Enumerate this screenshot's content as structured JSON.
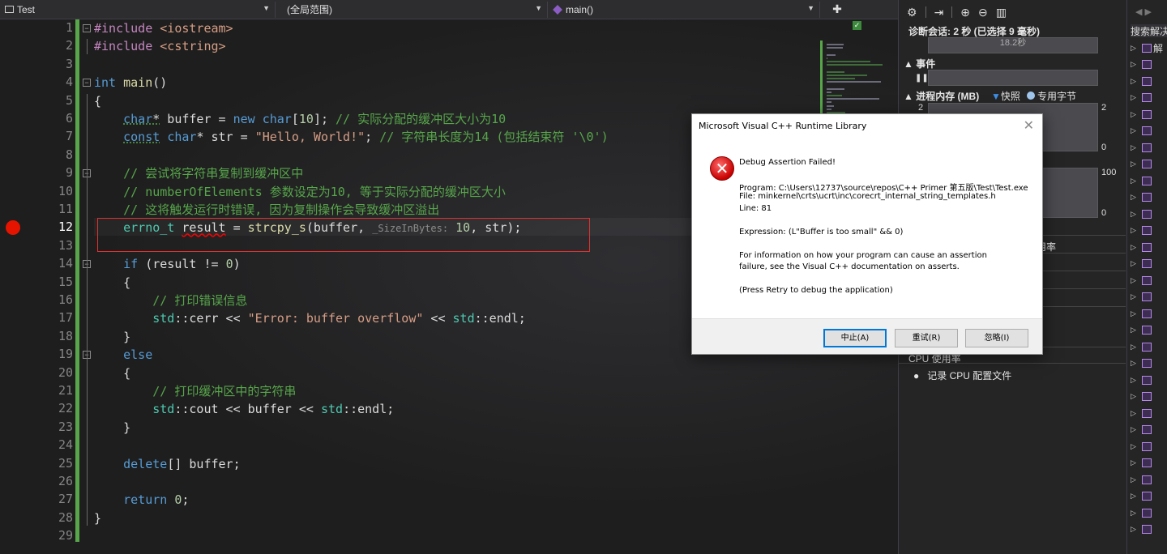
{
  "navbar": {
    "project": "Test",
    "scope": "(全局范围)",
    "member": "main()",
    "split_icon": "split-window-icon"
  },
  "editor": {
    "current_line": 12,
    "breakpoint_line": 12,
    "lines": [
      {
        "n": "1",
        "t": "#include <iostream>"
      },
      {
        "n": "2",
        "t": "#include <cstring>"
      },
      {
        "n": "3",
        "t": ""
      },
      {
        "n": "4",
        "t": "int main()"
      },
      {
        "n": "5",
        "t": "{"
      },
      {
        "n": "6",
        "t": "    char* buffer = new char[10]; // 实际分配的缓冲区大小为10"
      },
      {
        "n": "7",
        "t": "    const char* str = \"Hello, World!\"; // 字符串长度为14 (包括结束符 '\\0')"
      },
      {
        "n": "8",
        "t": ""
      },
      {
        "n": "9",
        "t": "    // 尝试将字符串复制到缓冲区中"
      },
      {
        "n": "10",
        "t": "    // numberOfElements 参数设定为10, 等于实际分配的缓冲区大小"
      },
      {
        "n": "11",
        "t": "    // 这将触发运行时错误, 因为复制操作会导致缓冲区溢出"
      },
      {
        "n": "12",
        "t": "    errno_t result = strcpy_s(buffer, _SizeInBytes: 10, str);"
      },
      {
        "n": "13",
        "t": ""
      },
      {
        "n": "14",
        "t": "    if (result != 0)"
      },
      {
        "n": "15",
        "t": "    {"
      },
      {
        "n": "16",
        "t": "        // 打印错误信息"
      },
      {
        "n": "17",
        "t": "        std::cerr << \"Error: buffer overflow\" << std::endl;"
      },
      {
        "n": "18",
        "t": "    }"
      },
      {
        "n": "19",
        "t": "    else"
      },
      {
        "n": "20",
        "t": "    {"
      },
      {
        "n": "21",
        "t": "        // 打印缓冲区中的字符串"
      },
      {
        "n": "22",
        "t": "        std::cout << buffer << std::endl;"
      },
      {
        "n": "23",
        "t": "    }"
      },
      {
        "n": "24",
        "t": ""
      },
      {
        "n": "25",
        "t": "    delete[] buffer;"
      },
      {
        "n": "26",
        "t": ""
      },
      {
        "n": "27",
        "t": "    return 0;"
      },
      {
        "n": "28",
        "t": "}"
      },
      {
        "n": "29",
        "t": ""
      }
    ]
  },
  "diagnostics": {
    "session": "诊断会话: 2 秒 (已选择 9 毫秒)",
    "timeline_label": "18.2秒",
    "events_title": "事件",
    "memory_title": "进程内存 (MB)",
    "snapshot_label": "快照",
    "private_bytes_label": "专用字节",
    "mem_axis_top_left": "2",
    "mem_axis_top_right": "2",
    "mem_axis_bottom_right": "0",
    "cpu_axis_top": "100",
    "cpu_axis_bottom": "0",
    "usage_tab_fragment": "用率",
    "cpu_title": "CPU 使用率",
    "cpu_record": "记录 CPU 配置文件"
  },
  "right_panel": {
    "search": "搜索解决",
    "solution_fragment": "解"
  },
  "dialog": {
    "title": "Microsoft Visual C++ Runtime Library",
    "heading": "Debug Assertion Failed!",
    "program": "Program: C:\\Users\\12737\\source\\repos\\C++ Primer 第五版\\Test\\Test.exe",
    "file": "File: minkernel\\crts\\ucrt\\inc\\corecrt_internal_string_templates.h",
    "line": "Line: 81",
    "expression": "Expression: (L\"Buffer is too small\" && 0)",
    "info1": "For information on how your program can cause an assertion",
    "info2": "failure, see the Visual C++ documentation on asserts.",
    "retry_hint": "(Press Retry to debug the application)",
    "abort_label": "中止(A)",
    "retry_label": "重试(R)",
    "ignore_label": "忽略(I)"
  },
  "colors": {
    "breakpoint": "#e51400",
    "change_bar": "#57a64a",
    "highlight_box": "#e03030",
    "error_icon": "#c80000",
    "default_button_border": "#0078d7"
  }
}
